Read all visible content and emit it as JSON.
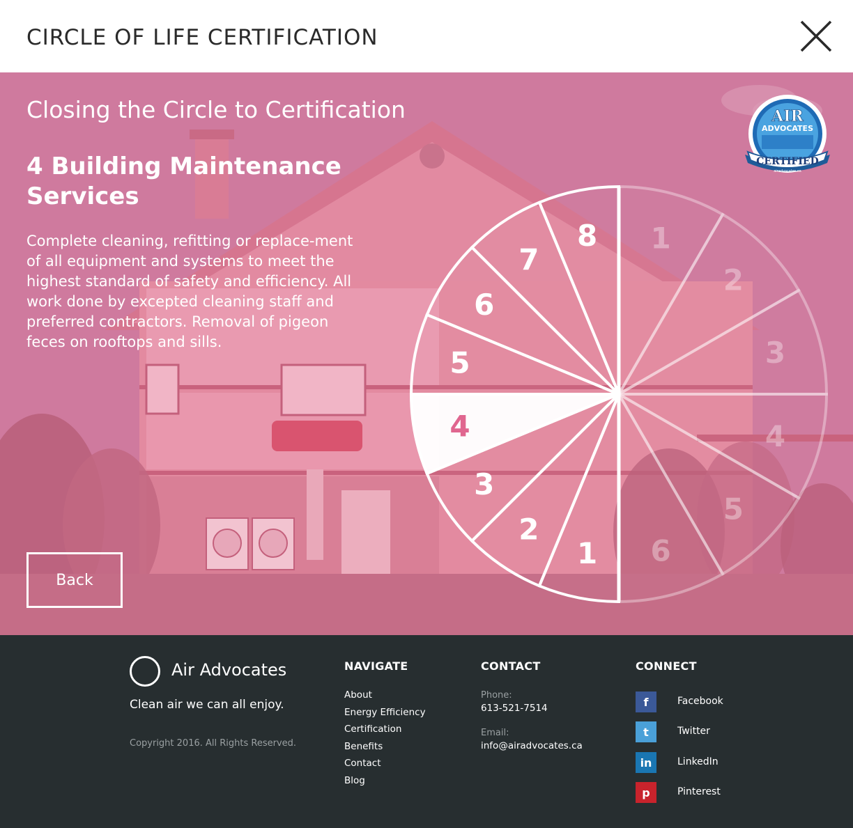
{
  "header": {
    "title": "CIRCLE OF LIFE CERTIFICATION"
  },
  "hero": {
    "heading": "Closing the Circle to Certification",
    "subheading": "4 Building Maintenance Services",
    "body": "Complete cleaning, refitting or replace-ment of all equipment and systems to meet the highest standard of safety and efficiency. All work done by excepted cleaning staff and preferred contractors. Removal of pigeon feces on rooftops and sills.",
    "back_label": "Back",
    "badge": {
      "line1": "AIR",
      "line2": "ADVOCATES",
      "line3": "CERTIFIED",
      "url": "airadvocates.ca"
    }
  },
  "wheel": {
    "active": "4",
    "left_segments": [
      "1",
      "2",
      "3",
      "4",
      "5",
      "6",
      "7",
      "8"
    ],
    "right_segments": [
      "1",
      "2",
      "3",
      "4",
      "5",
      "6"
    ]
  },
  "footer": {
    "brand": "Air Advocates",
    "tagline": "Clean air we can all enjoy.",
    "copyright": "Copyright 2016. All Rights Reserved.",
    "navigate": {
      "heading": "NAVIGATE",
      "links": [
        "About",
        "Energy Efficiency",
        "Certification",
        "Benefits",
        "Contact",
        "Blog"
      ]
    },
    "contact": {
      "heading": "CONTACT",
      "phone_label": "Phone:",
      "phone": "613-521-7514",
      "email_label": "Email:",
      "email": "info@airadvocates.ca"
    },
    "connect": {
      "heading": "CONNECT",
      "items": [
        {
          "label": "Facebook",
          "icon": "facebook-icon",
          "glyph": "f",
          "color": "#3b5998"
        },
        {
          "label": "Twitter",
          "icon": "twitter-icon",
          "glyph": "t",
          "color": "#4aa0d8"
        },
        {
          "label": "LinkedIn",
          "icon": "linkedin-icon",
          "glyph": "in",
          "color": "#1a76b2"
        },
        {
          "label": "Pinterest",
          "icon": "pinterest-icon",
          "glyph": "p",
          "color": "#c8232c"
        }
      ]
    }
  },
  "colors": {
    "hero_pink": "#cf7a9e",
    "footer_bg": "#272e30",
    "active_number": "#e0668f"
  }
}
